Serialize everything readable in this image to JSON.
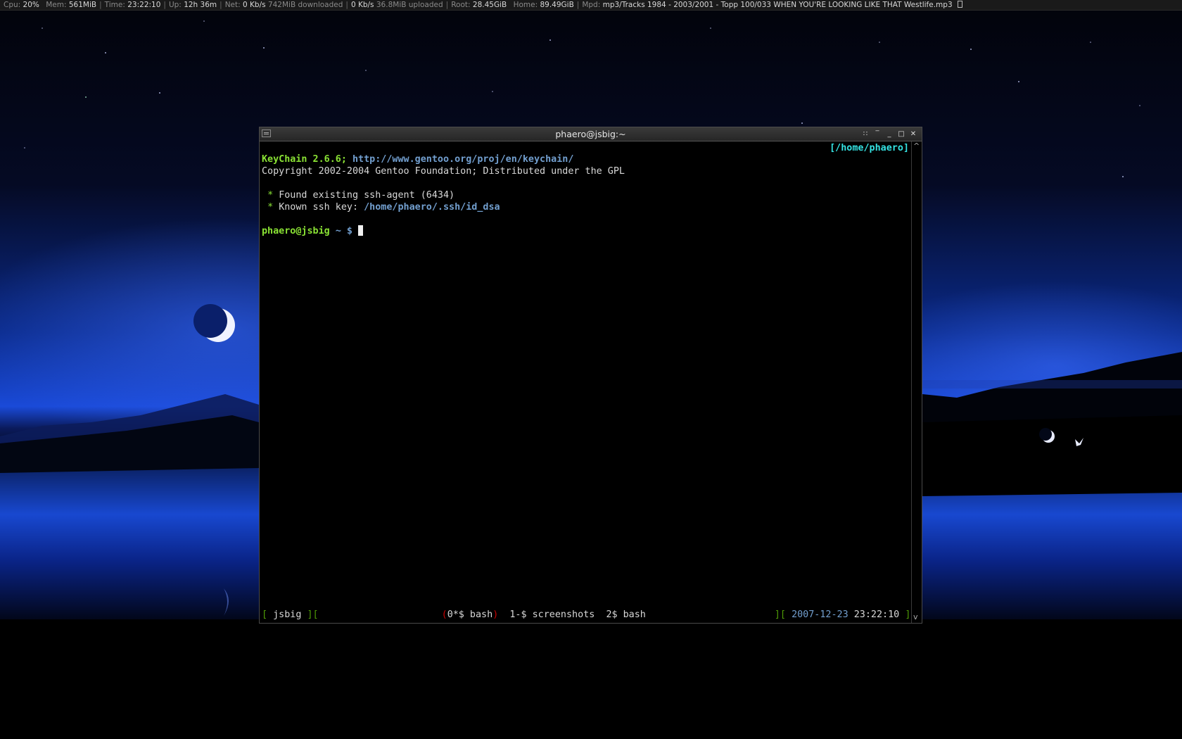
{
  "statusbar": {
    "cpu_label": "Cpu:",
    "cpu": "20%",
    "mem_label": "Mem:",
    "mem": "561MiB",
    "time_label": "Time:",
    "time": "23:22:10",
    "up_label": "Up:",
    "up": "12h 36m",
    "net_label": "Net:",
    "net_down_rate": "0 Kb/s",
    "net_downloaded": "742MiB downloaded",
    "net_up_rate": "0 Kb/s",
    "net_uploaded": "36.8MiB uploaded",
    "root_label": "Root:",
    "root": "28.45GiB",
    "home_label": "Home:",
    "home": "89.49GiB",
    "mpd_label": "Mpd:",
    "mpd": "mp3/Tracks 1984 - 2003/2001 - Topp 100/033 WHEN YOU'RE LOOKING LIKE THAT Westlife.mp3",
    "tray_icon": "tray-box-icon"
  },
  "window": {
    "title": "phaero@jsbig:~",
    "icons": [
      "window-menu-icon",
      "sticky-icon",
      "shade-icon",
      "minimize-icon",
      "maximize-icon",
      "close-icon"
    ]
  },
  "terminal": {
    "cwd": "[/home/phaero]",
    "keychain_name": "KeyChain 2.6.6;",
    "keychain_url": "http://www.gentoo.org/proj/en/keychain/",
    "copyright": "Copyright 2002-2004 Gentoo Foundation; Distributed under the GPL",
    "bullet": "*",
    "found_agent": "Found existing ssh-agent (6434)",
    "known_key_label": "Known ssh key:",
    "known_key_path": "/home/phaero/.ssh/id_dsa",
    "prompt_user": "phaero@jsbig",
    "prompt_dir": "~ $"
  },
  "hardstatus": {
    "open": "[",
    "host": "jsbig",
    "sep1": "][",
    "win0_open": "(",
    "win0": "0*$ bash",
    "win0_close": ")",
    "win1": "1-$ screenshots",
    "win2": "2$ bash",
    "sep2": "][",
    "date": "2007-12-23",
    "time": "23:22:10",
    "close": "]"
  },
  "colors": {
    "prompt_green": "#8ae234",
    "link_blue": "#729fcf",
    "cwd_cyan": "#34e2e2",
    "bracket_green": "#4e9a06",
    "active_red": "#cc0000"
  }
}
